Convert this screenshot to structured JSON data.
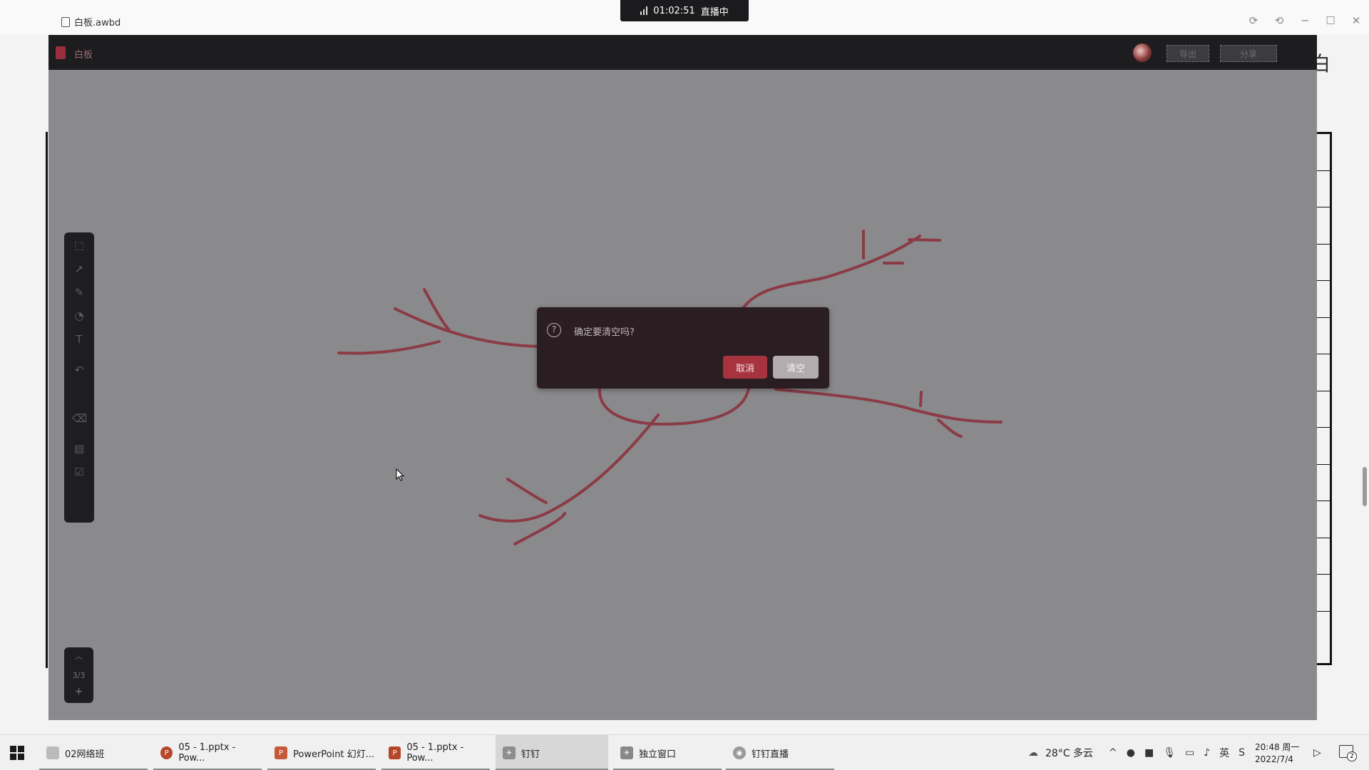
{
  "window": {
    "title": "白板.awbd",
    "live_timer": "01:02:51",
    "live_status": "直播中"
  },
  "app": {
    "name": "白板",
    "export_label": "导出",
    "share_label": "分享",
    "page_indicator": "3/3",
    "add_page": "+"
  },
  "toolbar": {
    "tools": [
      "new-page-icon",
      "select-icon",
      "pen-icon",
      "shapes-icon",
      "text-icon",
      "undo-icon",
      "eraser-icon",
      "toolbox-icon",
      "edit-box-icon"
    ],
    "text_glyph": "T"
  },
  "dialog": {
    "message": "确定要清空吗?",
    "cancel_label": "取消",
    "clear_label": "清空",
    "icon_glyph": "?"
  },
  "side_glyph": "白",
  "taskbar": {
    "items": [
      {
        "label": "02网络班"
      },
      {
        "label": "05 - 1.pptx - Pow..."
      },
      {
        "label": "PowerPoint 幻灯..."
      },
      {
        "label": "05 - 1.pptx - Pow..."
      },
      {
        "label": "钉钉"
      },
      {
        "label": "独立窗口"
      },
      {
        "label": "钉钉直播"
      }
    ],
    "weather": "28°C 多云",
    "time": "20:48 周一",
    "date": "2022/7/4",
    "notifications": "2"
  },
  "colors": {
    "canvas": "#8a898b",
    "stroke": "#8b2e3a",
    "header": "#1d1c1e",
    "dialog": "#2b1e22",
    "cancel": "#a7333f"
  }
}
